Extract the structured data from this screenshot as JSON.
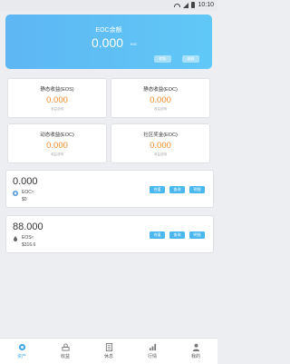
{
  "balance": {
    "title": "EOC余额",
    "value": "0.000",
    "unit": "eoc",
    "button_left": "转账",
    "button_right": "收款"
  },
  "stats": [
    {
      "label": "静态收益(EOS)",
      "value": "0.000",
      "sub": "收益说明"
    },
    {
      "label": "静态收益(EOC)",
      "value": "0.000",
      "sub": "收益说明"
    },
    {
      "label": "动态收益(EOC)",
      "value": "0.000",
      "sub": "收益说明"
    },
    {
      "label": "社区奖金(EOC)",
      "value": "0.000",
      "sub": "收益说明"
    }
  ],
  "assets": [
    {
      "amount": "0.000",
      "coin": "EOC≈",
      "coin_value": "$0",
      "icon": "eoc-coin-icon",
      "actions": [
        "充值",
        "查询",
        "明细"
      ]
    },
    {
      "amount": "88.000",
      "coin": "EOS≈",
      "coin_value": "$316.6",
      "icon": "eos-drop-icon",
      "actions": [
        "充值",
        "查询",
        "明细"
      ]
    }
  ],
  "tabs": [
    {
      "label": "资产",
      "icon": "wallet-icon",
      "active": true
    },
    {
      "label": "收益",
      "icon": "coins-icon",
      "active": false
    },
    {
      "label": "休息",
      "icon": "document-icon",
      "active": false
    },
    {
      "label": "行情",
      "icon": "chart-icon",
      "active": false
    },
    {
      "label": "我的",
      "icon": "person-icon",
      "active": false
    }
  ],
  "statusbar": {
    "time": "10:10"
  },
  "colors": {
    "accent": "#4ab8ee",
    "orange": "#f08a2c",
    "card_start": "#5eb6f3",
    "card_end": "#60c8f6"
  }
}
